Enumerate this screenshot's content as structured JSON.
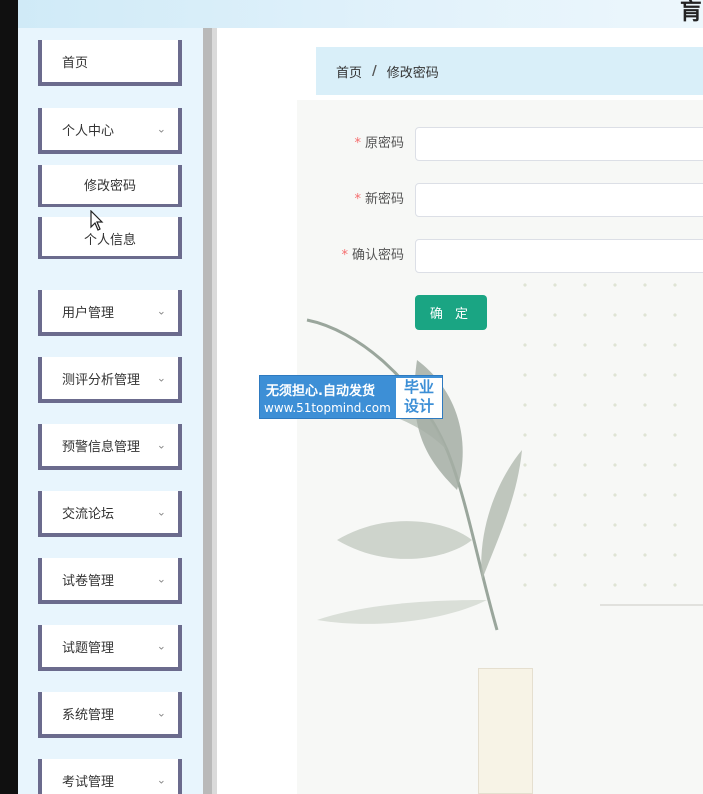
{
  "header": {
    "title": "肓"
  },
  "sidebar": {
    "items": [
      {
        "label": "首页",
        "has_chevron": false
      },
      {
        "label": "个人中心",
        "has_chevron": true
      },
      {
        "label": "用户管理",
        "has_chevron": true
      },
      {
        "label": "测评分析管理",
        "has_chevron": true
      },
      {
        "label": "预警信息管理",
        "has_chevron": true
      },
      {
        "label": "交流论坛",
        "has_chevron": true
      },
      {
        "label": "试卷管理",
        "has_chevron": true
      },
      {
        "label": "试题管理",
        "has_chevron": true
      },
      {
        "label": "系统管理",
        "has_chevron": true
      },
      {
        "label": "考试管理",
        "has_chevron": true
      }
    ],
    "sub_items": [
      {
        "label": "修改密码"
      },
      {
        "label": "个人信息"
      }
    ],
    "chevron_icon": "chevron-down-icon"
  },
  "breadcrumb": {
    "home": "首页",
    "separator": "/",
    "current": "修改密码"
  },
  "form": {
    "required_mark": "*",
    "old_password_label": "原密码",
    "new_password_label": "新密码",
    "confirm_password_label": "确认密码",
    "old_password_value": "",
    "new_password_value": "",
    "confirm_password_value": "",
    "submit_label": "确 定"
  },
  "watermark": {
    "line1": "无须担心.自动发货",
    "line2": "www.51topmind.com",
    "badge_line1": "毕业",
    "badge_line2": "设计"
  },
  "colors": {
    "accent": "#1aa583",
    "breadcrumb_bg": "#d9eff9",
    "sidebar_bg": "#e8f5fd",
    "menu_border": "#6b6b8d",
    "required": "#f56c6c",
    "watermark_bg": "#3d8fd6"
  }
}
